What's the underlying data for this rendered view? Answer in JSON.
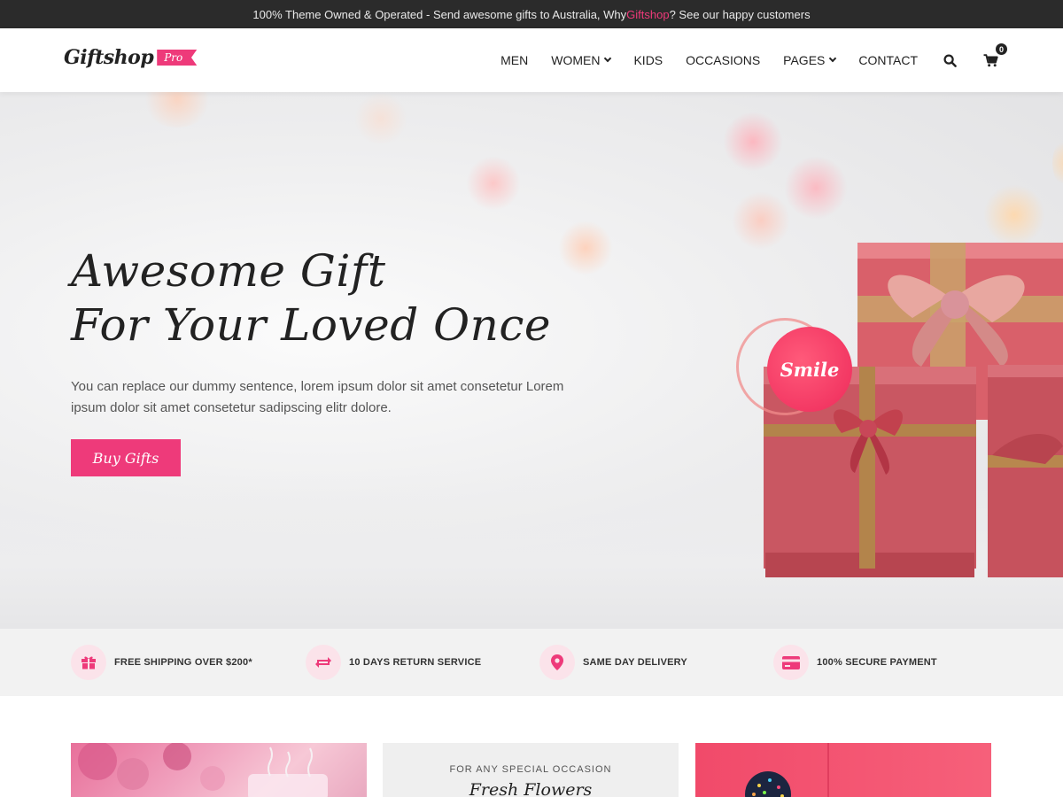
{
  "topbar": {
    "text_before": "100% Theme Owned & Operated - Send awesome gifts to Australia, Why ",
    "highlight": "Giftshop",
    "text_after": "? See our happy customers"
  },
  "header": {
    "logo": "Giftshop",
    "logo_badge": "Pro",
    "nav": [
      {
        "label": "MEN"
      },
      {
        "label": "WOMEN"
      },
      {
        "label": "KIDS"
      },
      {
        "label": "OCCASIONS"
      },
      {
        "label": "PAGES"
      },
      {
        "label": "CONTACT"
      }
    ],
    "cart_count": "0"
  },
  "hero": {
    "title_line1": "Awesome Gift",
    "title_line2": "For Your Loved Once",
    "description": "You can replace our dummy sentence, lorem ipsum dolor sit amet consetetur Lorem ipsum dolor sit amet consetetur sadipscing elitr dolore.",
    "button": "Buy Gifts",
    "badge": "Smile"
  },
  "features": [
    {
      "icon": "gift-icon",
      "label": "FREE SHIPPING OVER $200*"
    },
    {
      "icon": "return-icon",
      "label": "10 DAYS RETURN SERVICE"
    },
    {
      "icon": "location-pin-icon",
      "label": "SAME DAY DELIVERY"
    },
    {
      "icon": "credit-card-icon",
      "label": "100% SECURE PAYMENT"
    }
  ],
  "cards": {
    "middle_eyebrow": "FOR ANY SPECIAL OCCASION",
    "middle_title": "Fresh Flowers"
  },
  "colors": {
    "accent": "#ee3a7a",
    "topbar_bg": "#2b2b2b",
    "feature_strip_bg": "#f2f2f2"
  }
}
